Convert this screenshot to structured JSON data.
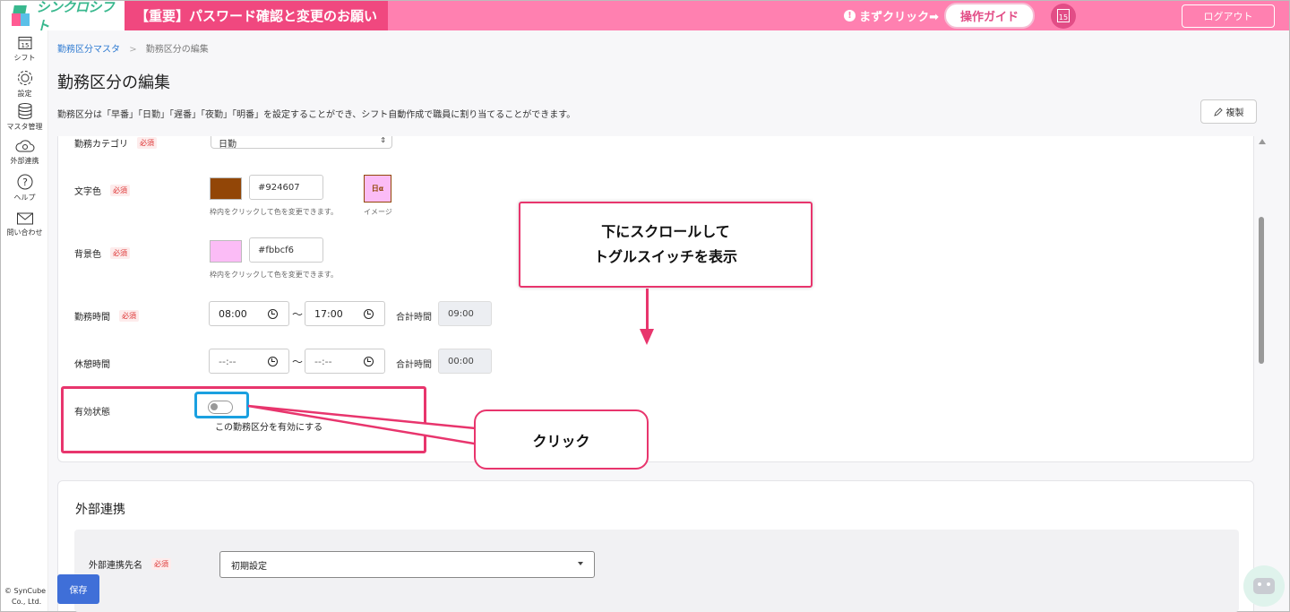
{
  "header": {
    "logo_text": "シンクロシフト",
    "notice": "【重要】パスワード確認と変更のお願い",
    "guide_hint": "まずクリック➡",
    "guide_button": "操作ガイド",
    "calendar_day": "15",
    "logout": "ログアウト"
  },
  "sidebar": {
    "items": [
      {
        "label": "シフト",
        "icon": "calendar-icon",
        "day": "15"
      },
      {
        "label": "設定",
        "icon": "gear-icon"
      },
      {
        "label": "マスタ管理",
        "icon": "database-icon"
      },
      {
        "label": "外部連携",
        "icon": "cloud-sync-icon"
      },
      {
        "label": "ヘルプ",
        "icon": "help-icon"
      },
      {
        "label": "問い合わせ",
        "icon": "mail-icon"
      }
    ],
    "copyright_line1": "© SynCube",
    "copyright_line2": "Co., Ltd."
  },
  "breadcrumb": {
    "link": "勤務区分マスタ",
    "separator": ">",
    "current": "勤務区分の編集"
  },
  "page": {
    "title": "勤務区分の編集",
    "description": "勤務区分は「早番」「日勤」「遅番」「夜勤」「明番」を設定することができ、シフト自動作成で職員に割り当てることができます。",
    "copy_button": "複製",
    "save_button": "保存"
  },
  "form": {
    "required": "必須",
    "category": {
      "label": "勤務カテゴリ",
      "value": "日勤"
    },
    "text_color": {
      "label": "文字色",
      "swatch": "#924607",
      "value": "#924607",
      "hint": "枠内をクリックして色を変更できます。",
      "preview_text": "日α",
      "preview_label": "イメージ"
    },
    "bg_color": {
      "label": "背景色",
      "swatch": "#fbbcf6",
      "value": "#fbbcf6",
      "hint": "枠内をクリックして色を変更できます。"
    },
    "work_time": {
      "label": "勤務時間",
      "start": "08:00",
      "end": "17:00",
      "separator": "〜",
      "total_label": "合計時間",
      "total": "09:00"
    },
    "break_time": {
      "label": "休憩時間",
      "start": "--:--",
      "end": "--:--",
      "separator": "〜",
      "total_label": "合計時間",
      "total": "00:00"
    },
    "active": {
      "label": "有効状態",
      "toggle_on": false,
      "toggle_text": "この勤務区分を有効にする"
    }
  },
  "external": {
    "title": "外部連携",
    "field_label": "外部連携先名",
    "field_value": "初期設定"
  },
  "annotations": {
    "scroll_line1": "下にスクロールして",
    "scroll_line2": "トグルスイッチを表示",
    "click": "クリック",
    "color": "#e8356d"
  }
}
